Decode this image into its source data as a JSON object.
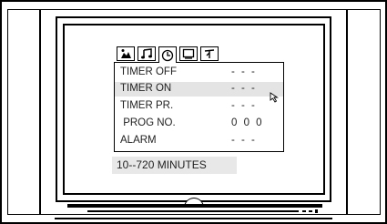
{
  "menu": {
    "tabs": [
      {
        "icon": "picture-icon",
        "active": false
      },
      {
        "icon": "sound-icon",
        "active": false
      },
      {
        "icon": "timer-icon",
        "active": true
      },
      {
        "icon": "screen-icon",
        "active": false
      },
      {
        "icon": "settings-icon",
        "active": false
      }
    ],
    "items": [
      {
        "label": "TIMER OFF",
        "value": "- - -"
      },
      {
        "label": "TIMER ON",
        "value": "- - -"
      },
      {
        "label": "TIMER PR.",
        "value": "- - -"
      },
      {
        "label": " PROG NO.",
        "value": "0 0 0"
      },
      {
        "label": "ALARM",
        "value": "- - -"
      }
    ],
    "selected_item": "TIMER ON"
  },
  "hint": {
    "text": "10--720 MINUTES"
  },
  "colors": {
    "outline": "#000000",
    "highlight": "#e4e4e4",
    "hint_bg": "#e8e8e8"
  }
}
